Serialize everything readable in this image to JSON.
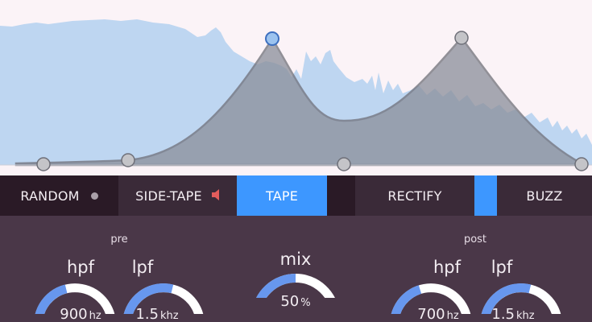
{
  "modes": [
    {
      "label": "RANDOM",
      "icon": "dot-icon",
      "state": "inactive"
    },
    {
      "label": "SIDE-TAPE",
      "icon": "speaker-icon",
      "state": "inactive"
    },
    {
      "label": "TAPE",
      "icon": "",
      "state": "active"
    },
    {
      "label": "RECTIFY",
      "icon": "",
      "state": "inactive"
    },
    {
      "label": "BUZZ",
      "icon": "",
      "state": "inactive"
    }
  ],
  "pre": {
    "label": "pre",
    "hpf": {
      "label": "hpf",
      "value": "900",
      "unit": "hz",
      "level": 0.42
    },
    "lpf": {
      "label": "lpf",
      "value": "1.5",
      "unit": "khz",
      "level": 0.58
    }
  },
  "mix": {
    "label": "mix",
    "value": "50",
    "unit": "%",
    "level": 0.5
  },
  "post": {
    "label": "post",
    "hpf": {
      "label": "hpf",
      "value": "700",
      "unit": "hz",
      "level": 0.4
    },
    "lpf": {
      "label": "lpf",
      "value": "1.5",
      "unit": "khz",
      "level": 0.58
    }
  },
  "colors": {
    "accent": "#3d97ff",
    "spectrum": "#b7d3ef",
    "curve_fill": "#8a8e9a",
    "knob_track": "#ffffff",
    "knob_fill": "#6797ee",
    "speaker": "#e25c5c"
  }
}
